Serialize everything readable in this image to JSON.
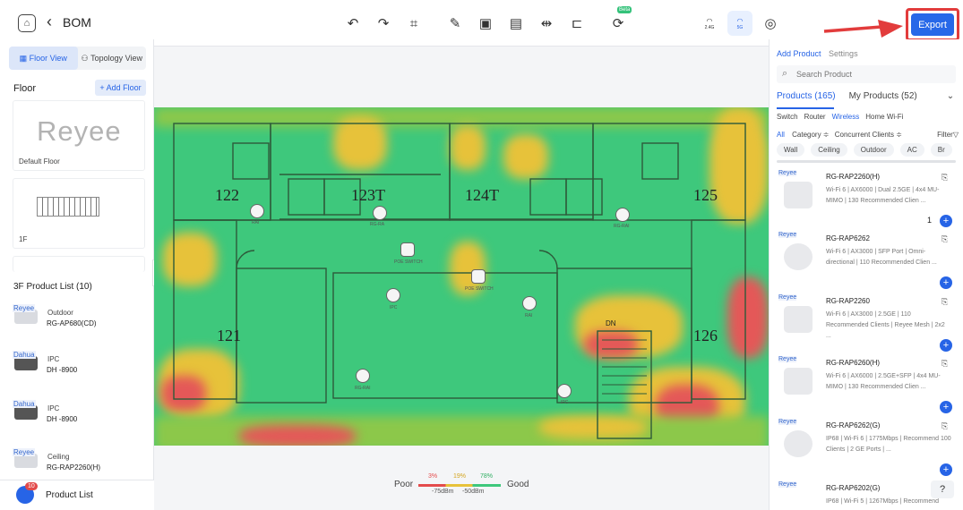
{
  "header": {
    "title": "BOM",
    "beta_label": "Beta",
    "band_24": "2.4G",
    "band_5": "5G",
    "export_label": "Export"
  },
  "left": {
    "view_tabs": [
      "Floor View",
      "Topology View"
    ],
    "floor_heading": "Floor",
    "add_floor_label": "+ Add Floor",
    "floors": [
      {
        "label": "Default Floor",
        "logo": "Reyee"
      },
      {
        "label": "1F"
      }
    ],
    "product_list_heading": "3F Product List (10)",
    "products": [
      {
        "brand": "Reyee",
        "type": "Outdoor",
        "model": "RG-AP680(CD)"
      },
      {
        "brand": "Dahua",
        "type": "IPC",
        "model": "DH -8900"
      },
      {
        "brand": "Dahua",
        "type": "IPC",
        "model": "DH -8900"
      },
      {
        "brand": "Reyee",
        "type": "Ceiling",
        "model": "RG-RAP2260(H)"
      }
    ],
    "product_list_label": "Product List",
    "product_list_count": "10"
  },
  "plan": {
    "rooms": [
      "122",
      "123T",
      "124T",
      "125",
      "121",
      "126",
      "DN"
    ],
    "devices": [
      {
        "label": "RAI"
      },
      {
        "label": "RG-RA"
      },
      {
        "label": "POE SWITCH"
      },
      {
        "label": "POE SWITCH"
      },
      {
        "label": "IPC"
      },
      {
        "label": "RAI"
      },
      {
        "label": "RG-RAI"
      },
      {
        "label": "RG-RAI"
      },
      {
        "label": "IPC"
      }
    ]
  },
  "legend": {
    "poor": "Poor",
    "good": "Good",
    "pct_red": "3%",
    "pct_yellow": "19%",
    "pct_green": "78%",
    "dbm_low": "-75dBm",
    "dbm_high": "-50dBm"
  },
  "right": {
    "tab_add_product": "Add Product",
    "tab_settings": "Settings",
    "search_placeholder": "Search Product",
    "products_tab": "Products (165)",
    "my_products_tab": "My Products (52)",
    "categories": [
      "Switch",
      "Router",
      "Wireless",
      "Home Wi-Fi"
    ],
    "filter_all": "All",
    "filter_category": "Category ≑",
    "filter_clients": "Concurrent Clients ≑",
    "filter_label": "Filter",
    "chips": [
      "Wall",
      "Ceiling",
      "Outdoor",
      "AC",
      "Br"
    ],
    "cards": [
      {
        "brand": "Reyee",
        "name": "RG-RAP2260(H)",
        "desc": "Wi-Fi 6 | AX6000 | Dual 2.5GE | 4x4 MU-MIMO | 130 Recommended Clien ...",
        "qty": "1"
      },
      {
        "brand": "Reyee",
        "name": "RG-RAP6262",
        "desc": "Wi-Fi 6 | AX3000 | SFP Port | Omni-directional | 110 Recommended Clien ...",
        "qty": ""
      },
      {
        "brand": "Reyee",
        "name": "RG-RAP2260",
        "desc": "Wi-Fi 6 | AX3000 | 2.5GE | 110 Recommended Clients | Reyee Mesh | 2x2 ...",
        "qty": ""
      },
      {
        "brand": "Reyee",
        "name": "RG-RAP6260(H)",
        "desc": "Wi-Fi 6 | AX6000 | 2.5GE+SFP | 4x4 MU-MIMO | 130 Recommended Clien ...",
        "qty": ""
      },
      {
        "brand": "Reyee",
        "name": "RG-RAP6262(G)",
        "desc": "IP68 | Wi-Fi 6 | 1775Mbps | Recommend 100 Clients | 2 GE Ports | ...",
        "qty": ""
      },
      {
        "brand": "Reyee",
        "name": "RG-RAP6202(G)",
        "desc": "IP68 | Wi-Fi 5 | 1267Mbps | Recommend",
        "qty": ""
      }
    ],
    "help_label": "?"
  }
}
